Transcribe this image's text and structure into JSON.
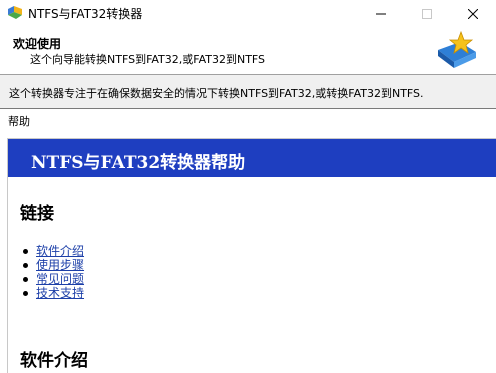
{
  "window": {
    "title": "NTFS与FAT32转换器",
    "icons": {
      "app": "app-icon",
      "minimize": "minimize-icon",
      "maximize": "maximize-icon",
      "close": "close-icon"
    }
  },
  "header": {
    "title": "欢迎使用",
    "subtitle": "这个向导能转换NTFS到FAT32,或FAT32到NTFS",
    "icon": "wizard-star-icon"
  },
  "description": "这个转换器专注于在确保数据安全的情况下转换NTFS到FAT32,或转换FAT32到NTFS.",
  "help": {
    "caption": "帮助",
    "banner_title": "NTFS与FAT32转换器帮助",
    "links_heading": "链接",
    "links": [
      {
        "label": "软件介绍"
      },
      {
        "label": "使用步骤"
      },
      {
        "label": "常见问题"
      },
      {
        "label": "技术支持"
      }
    ],
    "intro_heading": "软件介绍"
  },
  "colors": {
    "banner": "#1e3ec0",
    "link": "#1c3fa8",
    "band": "#f0f0f0"
  }
}
